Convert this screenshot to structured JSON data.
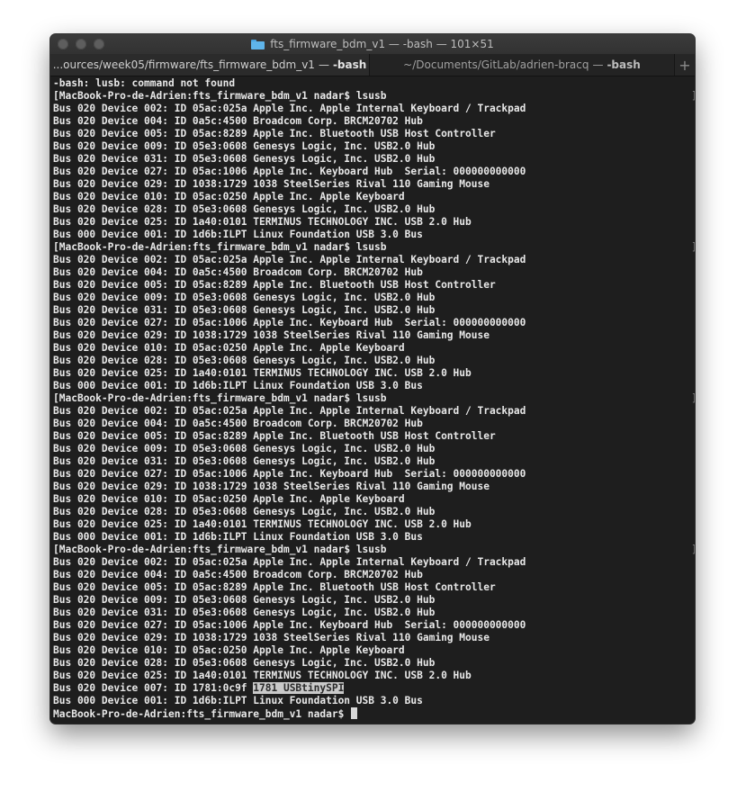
{
  "window": {
    "title": "fts_firmware_bdm_v1 — -bash — 101×51"
  },
  "tabs": [
    {
      "path": "...ources/week05/firmware/fts_firmware_bdm_v1",
      "process": "-bash"
    },
    {
      "path": "~/Documents/GitLab/adrien-bracq",
      "process": "-bash"
    }
  ],
  "new_tab_label": "+",
  "terminal": {
    "prompt": "MacBook-Pro-de-Adrien:fts_firmware_bdm_v1 nadar$",
    "command": "lsusb",
    "error": "-bash: lusb: command not found",
    "bracket_mark": "]",
    "blocks": [
      [
        "Bus 020 Device 002: ID 05ac:025a Apple Inc. Apple Internal Keyboard / Trackpad",
        "Bus 020 Device 004: ID 0a5c:4500 Broadcom Corp. BRCM20702 Hub",
        "Bus 020 Device 005: ID 05ac:8289 Apple Inc. Bluetooth USB Host Controller",
        "Bus 020 Device 009: ID 05e3:0608 Genesys Logic, Inc. USB2.0 Hub",
        "Bus 020 Device 031: ID 05e3:0608 Genesys Logic, Inc. USB2.0 Hub",
        "Bus 020 Device 027: ID 05ac:1006 Apple Inc. Keyboard Hub  Serial: 000000000000",
        "Bus 020 Device 029: ID 1038:1729 1038 SteelSeries Rival 110 Gaming Mouse",
        "Bus 020 Device 010: ID 05ac:0250 Apple Inc. Apple Keyboard",
        "Bus 020 Device 028: ID 05e3:0608 Genesys Logic, Inc. USB2.0 Hub",
        "Bus 020 Device 025: ID 1a40:0101 TERMINUS TECHNOLOGY INC. USB 2.0 Hub",
        "Bus 000 Device 001: ID 1d6b:ILPT Linux Foundation USB 3.0 Bus"
      ],
      [
        "Bus 020 Device 002: ID 05ac:025a Apple Inc. Apple Internal Keyboard / Trackpad",
        "Bus 020 Device 004: ID 0a5c:4500 Broadcom Corp. BRCM20702 Hub",
        "Bus 020 Device 005: ID 05ac:8289 Apple Inc. Bluetooth USB Host Controller",
        "Bus 020 Device 009: ID 05e3:0608 Genesys Logic, Inc. USB2.0 Hub",
        "Bus 020 Device 031: ID 05e3:0608 Genesys Logic, Inc. USB2.0 Hub",
        "Bus 020 Device 027: ID 05ac:1006 Apple Inc. Keyboard Hub  Serial: 000000000000",
        "Bus 020 Device 029: ID 1038:1729 1038 SteelSeries Rival 110 Gaming Mouse",
        "Bus 020 Device 010: ID 05ac:0250 Apple Inc. Apple Keyboard",
        "Bus 020 Device 028: ID 05e3:0608 Genesys Logic, Inc. USB2.0 Hub",
        "Bus 020 Device 025: ID 1a40:0101 TERMINUS TECHNOLOGY INC. USB 2.0 Hub",
        "Bus 000 Device 001: ID 1d6b:ILPT Linux Foundation USB 3.0 Bus"
      ],
      [
        "Bus 020 Device 002: ID 05ac:025a Apple Inc. Apple Internal Keyboard / Trackpad",
        "Bus 020 Device 004: ID 0a5c:4500 Broadcom Corp. BRCM20702 Hub",
        "Bus 020 Device 005: ID 05ac:8289 Apple Inc. Bluetooth USB Host Controller",
        "Bus 020 Device 009: ID 05e3:0608 Genesys Logic, Inc. USB2.0 Hub",
        "Bus 020 Device 031: ID 05e3:0608 Genesys Logic, Inc. USB2.0 Hub",
        "Bus 020 Device 027: ID 05ac:1006 Apple Inc. Keyboard Hub  Serial: 000000000000",
        "Bus 020 Device 029: ID 1038:1729 1038 SteelSeries Rival 110 Gaming Mouse",
        "Bus 020 Device 010: ID 05ac:0250 Apple Inc. Apple Keyboard",
        "Bus 020 Device 028: ID 05e3:0608 Genesys Logic, Inc. USB2.0 Hub",
        "Bus 020 Device 025: ID 1a40:0101 TERMINUS TECHNOLOGY INC. USB 2.0 Hub",
        "Bus 000 Device 001: ID 1d6b:ILPT Linux Foundation USB 3.0 Bus"
      ],
      [
        "Bus 020 Device 002: ID 05ac:025a Apple Inc. Apple Internal Keyboard / Trackpad",
        "Bus 020 Device 004: ID 0a5c:4500 Broadcom Corp. BRCM20702 Hub",
        "Bus 020 Device 005: ID 05ac:8289 Apple Inc. Bluetooth USB Host Controller",
        "Bus 020 Device 009: ID 05e3:0608 Genesys Logic, Inc. USB2.0 Hub",
        "Bus 020 Device 031: ID 05e3:0608 Genesys Logic, Inc. USB2.0 Hub",
        "Bus 020 Device 027: ID 05ac:1006 Apple Inc. Keyboard Hub  Serial: 000000000000",
        "Bus 020 Device 029: ID 1038:1729 1038 SteelSeries Rival 110 Gaming Mouse",
        "Bus 020 Device 010: ID 05ac:0250 Apple Inc. Apple Keyboard",
        "Bus 020 Device 028: ID 05e3:0608 Genesys Logic, Inc. USB2.0 Hub",
        "Bus 020 Device 025: ID 1a40:0101 TERMINUS TECHNOLOGY INC. USB 2.0 Hub",
        {
          "prefix": "Bus 020 Device 007: ID 1781:0c9f ",
          "selected": "1781 USBtinySPI"
        },
        "Bus 000 Device 001: ID 1d6b:ILPT Linux Foundation USB 3.0 Bus"
      ]
    ]
  },
  "colors": {
    "background": "#1e1e1e",
    "text": "#e8e8e8",
    "selection": "#c9c9c9",
    "folder_icon": "#5fb4ea"
  }
}
